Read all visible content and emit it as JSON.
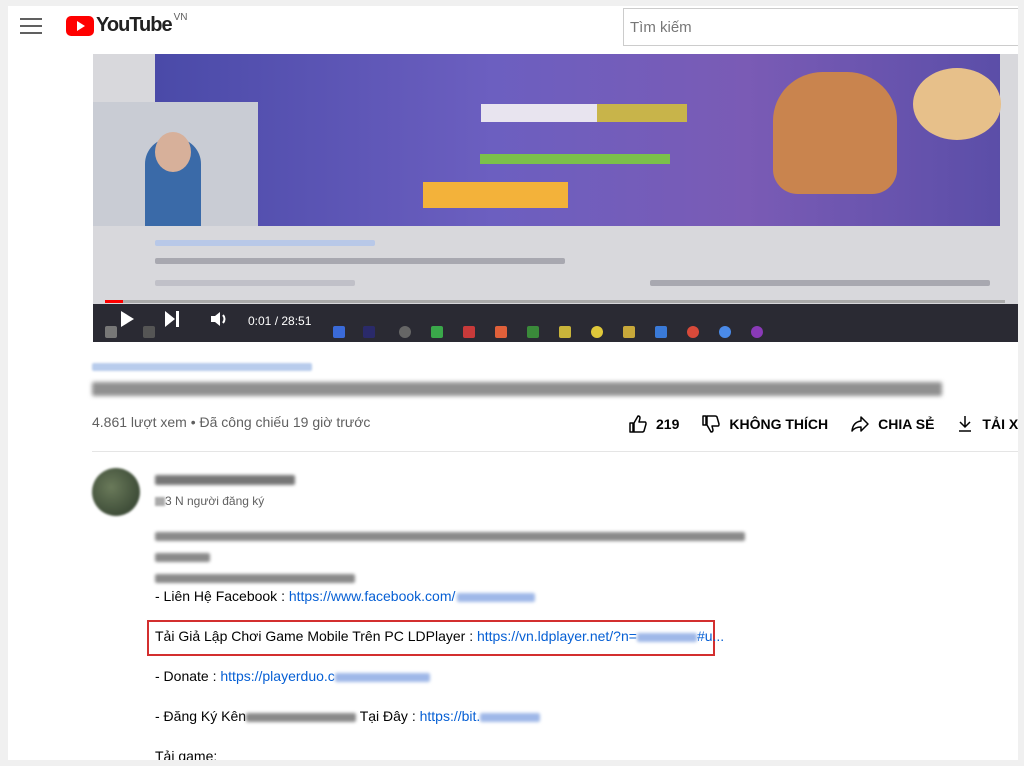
{
  "masthead": {
    "logo_text": "YouTube",
    "country_code": "VN",
    "search_placeholder": "Tìm kiếm",
    "menu_icon": "hamburger-menu-icon"
  },
  "player": {
    "time": "0:01 / 28:51",
    "progress_fraction": 0.02
  },
  "video": {
    "views": "4.861 lượt xem • Đã công chiếu 19 giờ trước",
    "actions": {
      "like_count": "219",
      "dislike_label": "KHÔNG THÍCH",
      "share_label": "CHIA SẺ",
      "download_label": "TẢI XU"
    }
  },
  "channel": {
    "subscribers": "3 N người đăng ký"
  },
  "description": {
    "facebook_label": "- Liên Hệ Facebook : ",
    "facebook_link": "https://www.facebook.com/",
    "ldplayer_label": "Tải Giả Lập Chơi Game Mobile Trên PC LDPlayer : ",
    "ldplayer_link_start": "https://vn.ldplayer.net/?n=",
    "ldplayer_link_end": "#u...",
    "donate_label": "- Donate : ",
    "donate_link": "https://playerduo.c",
    "subscribe_label_start": "- Đăng Ký Kên",
    "subscribe_label_end": " Tại Đây : ",
    "subscribe_link": "https://bit.",
    "download_game_label": "Tải game:"
  },
  "colors": {
    "link": "#065fd4",
    "highlight_border": "#d32f2f",
    "youtube_red": "#ff0000"
  }
}
